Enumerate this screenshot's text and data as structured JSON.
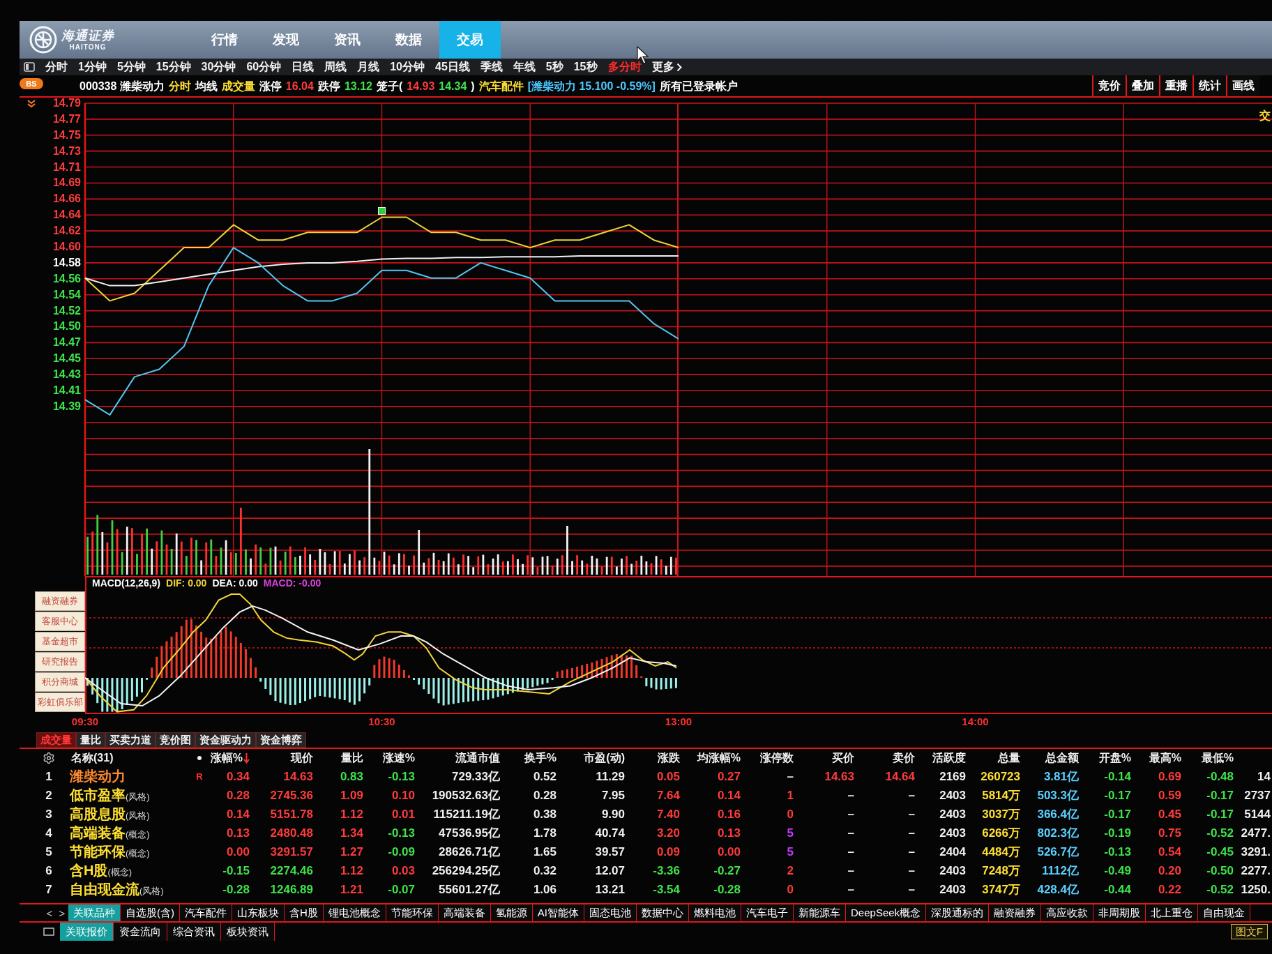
{
  "title_bar": {
    "logo_text": "海通证券",
    "logo_latin": "HAITONG",
    "menu": [
      {
        "label": "行情",
        "selected": false
      },
      {
        "label": "发现",
        "selected": false
      },
      {
        "label": "资讯",
        "selected": false
      },
      {
        "label": "数据",
        "selected": false
      },
      {
        "label": "交易",
        "selected": true
      }
    ]
  },
  "period_bar": {
    "items": [
      {
        "label": "分时",
        "selected": false
      },
      {
        "label": "1分钟",
        "selected": false
      },
      {
        "label": "5分钟",
        "selected": false
      },
      {
        "label": "15分钟",
        "selected": false
      },
      {
        "label": "30分钟",
        "selected": false
      },
      {
        "label": "60分钟",
        "selected": false
      },
      {
        "label": "日线",
        "selected": false
      },
      {
        "label": "周线",
        "selected": false
      },
      {
        "label": "月线",
        "selected": false
      },
      {
        "label": "10分钟",
        "selected": false
      },
      {
        "label": "45日线",
        "selected": false
      },
      {
        "label": "季线",
        "selected": false
      },
      {
        "label": "年线",
        "selected": false
      },
      {
        "label": "5秒",
        "selected": false
      },
      {
        "label": "15秒",
        "selected": false
      },
      {
        "label": "多分时",
        "selected": true
      }
    ],
    "more": "更多"
  },
  "info_bar": {
    "badge": "BS",
    "segments": [
      {
        "text": "000338 潍柴动力",
        "color": "#ffffff"
      },
      {
        "text": "分时",
        "color": "#ffe033"
      },
      {
        "text": "均线",
        "color": "#ffffff"
      },
      {
        "text": "成交量",
        "color": "#ffe033"
      },
      {
        "text": "涨停",
        "color": "#ffffff"
      },
      {
        "text": "16.04",
        "color": "#ff3b3b"
      },
      {
        "text": "跌停",
        "color": "#ffffff"
      },
      {
        "text": "13.12",
        "color": "#3ee34a"
      },
      {
        "text": "笼子(",
        "color": "#ffffff"
      },
      {
        "text": "14.93",
        "color": "#ff3b3b"
      },
      {
        "text": "14.34",
        "color": "#3ee34a"
      },
      {
        "text": ")",
        "color": "#ffffff"
      },
      {
        "text": "汽车配件",
        "color": "#ffe033"
      },
      {
        "text": "[潍柴动力 15.100 -0.59%]",
        "color": "#4cc9ff"
      },
      {
        "text": "所有已登录帐户",
        "color": "#ffffff"
      }
    ],
    "tools": [
      "竞价",
      "叠加",
      "重播",
      "统计",
      "画线"
    ]
  },
  "price_chart": {
    "edge_label": "交",
    "chart_data": [
      {
        "type": "line",
        "categories": [
          null,
          null,
          null,
          null,
          null,
          null,
          null,
          null,
          null,
          null,
          null,
          null,
          null,
          null,
          null,
          null,
          null,
          null,
          null,
          null,
          null,
          null,
          null,
          null,
          null
        ],
        "ylim": [
          14.168,
          14.79
        ],
        "yticks": [
          {
            "value": 14.79,
            "label": "14.79"
          },
          {
            "value": 14.769,
            "label": "14.77"
          },
          {
            "value": 14.748,
            "label": "14.75"
          },
          {
            "value": 14.727,
            "label": "14.73"
          },
          {
            "value": 14.706,
            "label": "14.71"
          },
          {
            "value": 14.685,
            "label": "14.69"
          },
          {
            "value": 14.664,
            "label": "14.66"
          },
          {
            "value": 14.643,
            "label": "14.64"
          },
          {
            "value": 14.622,
            "label": "14.62"
          },
          {
            "value": 14.601,
            "label": "14.60"
          },
          {
            "value": 14.58,
            "label": "14.58"
          },
          {
            "value": 14.559,
            "label": "14.56"
          },
          {
            "value": 14.538,
            "label": "14.54"
          },
          {
            "value": 14.517,
            "label": "14.52"
          },
          {
            "value": 14.496,
            "label": "14.50"
          },
          {
            "value": 14.475,
            "label": "14.47"
          },
          {
            "value": 14.454,
            "label": "14.45"
          },
          {
            "value": 14.433,
            "label": "14.43"
          },
          {
            "value": 14.412,
            "label": "14.41"
          },
          {
            "value": 14.391,
            "label": "14.39"
          }
        ],
        "tick_labels": "y",
        "grid": true,
        "series": [
          {
            "color": "#f2d43a",
            "values": [
              14.56,
              14.53,
              14.54,
              14.57,
              14.6,
              14.6,
              14.63,
              14.61,
              14.61,
              14.62,
              14.62,
              14.62,
              14.64,
              14.64,
              14.62,
              14.62,
              14.61,
              14.61,
              14.6,
              14.61,
              14.61,
              14.62,
              14.63,
              14.61,
              14.6
            ]
          },
          {
            "color": "#f0f0f0",
            "values": [
              14.56,
              14.55,
              14.55,
              14.555,
              14.56,
              14.565,
              14.57,
              14.575,
              14.578,
              14.58,
              14.58,
              14.582,
              14.585,
              14.586,
              14.586,
              14.587,
              14.587,
              14.588,
              14.588,
              14.588,
              14.589,
              14.589,
              14.589,
              14.589,
              14.589
            ]
          },
          {
            "color": "#52c6f2",
            "values": [
              14.4,
              14.38,
              14.43,
              14.44,
              14.47,
              14.55,
              14.6,
              14.58,
              14.55,
              14.53,
              14.53,
              14.54,
              14.57,
              14.57,
              14.56,
              14.56,
              14.58,
              14.57,
              14.56,
              14.53,
              14.53,
              14.53,
              14.53,
              14.5,
              14.48
            ]
          }
        ]
      }
    ]
  },
  "indicator": {
    "name": "MACD(12,26,9)",
    "values": [
      {
        "text": "DIF: 0.00",
        "color": "#f2d43a"
      },
      {
        "text": "DEA: 0.00",
        "color": "#ffffff"
      },
      {
        "text": "MACD: -0.00",
        "color": "#e040e0"
      }
    ],
    "time_axis": [
      "09:30",
      "10:30",
      "13:00",
      "14:00"
    ]
  },
  "side_menu": [
    "融资融券",
    "客服中心",
    "基金超市",
    "研究报告",
    "积分商城",
    "彩虹俱乐部"
  ],
  "chart_tabs": [
    {
      "label": "成交量",
      "selected": true
    },
    {
      "label": "量比",
      "selected": false
    },
    {
      "label": "买卖力道",
      "selected": false
    },
    {
      "label": "竞价图",
      "selected": false
    },
    {
      "label": "资金驱动力",
      "selected": false
    },
    {
      "label": "资金博弈",
      "selected": false
    }
  ],
  "table": {
    "name_header": "名称(31)",
    "columns": [
      {
        "label": "涨幅%",
        "sorted": true
      },
      {
        "label": "现价",
        "sorted": false
      },
      {
        "label": "量比",
        "sorted": false
      },
      {
        "label": "涨速%",
        "sorted": false
      },
      {
        "label": "流通市值",
        "sorted": false
      },
      {
        "label": "换手%",
        "sorted": false
      },
      {
        "label": "市盈(动)",
        "sorted": false
      },
      {
        "label": "涨跌",
        "sorted": false
      },
      {
        "label": "均涨幅%",
        "sorted": false
      },
      {
        "label": "涨停数",
        "sorted": false
      },
      {
        "label": "买价",
        "sorted": false
      },
      {
        "label": "卖价",
        "sorted": false
      },
      {
        "label": "活跃度",
        "sorted": false
      },
      {
        "label": "总量",
        "sorted": false
      },
      {
        "label": "总金额",
        "sorted": false
      },
      {
        "label": "开盘%",
        "sorted": false
      },
      {
        "label": "最高%",
        "sorted": false
      },
      {
        "label": "最低%",
        "sorted": false
      }
    ],
    "rows": [
      {
        "rank": "1",
        "name": {
          "text": "潍柴动力",
          "color": "#ff8a2e"
        },
        "flag": "R",
        "cells": [
          {
            "text": "0.34",
            "color": "#ff3b3b"
          },
          {
            "text": "14.63",
            "color": "#ff3b3b"
          },
          {
            "text": "0.83",
            "color": "#3ee34a"
          },
          {
            "text": "-0.13",
            "color": "#3ee34a"
          },
          {
            "text": "729.33亿",
            "color": "#f0f0f0"
          },
          {
            "text": "0.52",
            "color": "#f0f0f0"
          },
          {
            "text": "11.29",
            "color": "#f0f0f0"
          },
          {
            "text": "0.05",
            "color": "#ff3b3b"
          },
          {
            "text": "0.27",
            "color": "#ff3b3b"
          },
          {
            "text": "–",
            "color": "#f0f0f0"
          },
          {
            "text": "14.63",
            "color": "#ff3b3b"
          },
          {
            "text": "14.64",
            "color": "#ff3b3b"
          },
          {
            "text": "2169",
            "color": "#f0f0f0"
          },
          {
            "text": "260723",
            "color": "#ffe033"
          },
          {
            "text": "3.81亿",
            "color": "#5ad0ff"
          },
          {
            "text": "-0.14",
            "color": "#3ee34a"
          },
          {
            "text": "0.69",
            "color": "#ff3b3b"
          },
          {
            "text": "-0.48",
            "color": "#3ee34a"
          },
          {
            "text": "14",
            "color": "#f0f0f0"
          }
        ]
      },
      {
        "rank": "2",
        "name": {
          "text": "低市盈率",
          "color": "#ffe033"
        },
        "tag": "(风格)",
        "cells": [
          {
            "text": "0.28",
            "color": "#ff3b3b"
          },
          {
            "text": "2745.36",
            "color": "#ff3b3b"
          },
          {
            "text": "1.09",
            "color": "#ff3b3b"
          },
          {
            "text": "0.10",
            "color": "#ff3b3b"
          },
          {
            "text": "190532.63亿",
            "color": "#f0f0f0"
          },
          {
            "text": "0.28",
            "color": "#f0f0f0"
          },
          {
            "text": "7.95",
            "color": "#f0f0f0"
          },
          {
            "text": "7.64",
            "color": "#ff3b3b"
          },
          {
            "text": "0.14",
            "color": "#ff3b3b"
          },
          {
            "text": "1",
            "color": "#ff3b3b"
          },
          {
            "text": "–",
            "color": "#f0f0f0"
          },
          {
            "text": "–",
            "color": "#f0f0f0"
          },
          {
            "text": "2403",
            "color": "#f0f0f0"
          },
          {
            "text": "5814万",
            "color": "#ffe033"
          },
          {
            "text": "503.3亿",
            "color": "#5ad0ff"
          },
          {
            "text": "-0.17",
            "color": "#3ee34a"
          },
          {
            "text": "0.59",
            "color": "#ff3b3b"
          },
          {
            "text": "-0.17",
            "color": "#3ee34a"
          },
          {
            "text": "2737",
            "color": "#f0f0f0"
          }
        ]
      },
      {
        "rank": "3",
        "name": {
          "text": "高股息股",
          "color": "#ffe033"
        },
        "tag": "(风格)",
        "cells": [
          {
            "text": "0.14",
            "color": "#ff3b3b"
          },
          {
            "text": "5151.78",
            "color": "#ff3b3b"
          },
          {
            "text": "1.12",
            "color": "#ff3b3b"
          },
          {
            "text": "0.01",
            "color": "#ff3b3b"
          },
          {
            "text": "115211.19亿",
            "color": "#f0f0f0"
          },
          {
            "text": "0.38",
            "color": "#f0f0f0"
          },
          {
            "text": "9.90",
            "color": "#f0f0f0"
          },
          {
            "text": "7.40",
            "color": "#ff3b3b"
          },
          {
            "text": "0.16",
            "color": "#ff3b3b"
          },
          {
            "text": "0",
            "color": "#ff3b3b"
          },
          {
            "text": "–",
            "color": "#f0f0f0"
          },
          {
            "text": "–",
            "color": "#f0f0f0"
          },
          {
            "text": "2403",
            "color": "#f0f0f0"
          },
          {
            "text": "3037万",
            "color": "#ffe033"
          },
          {
            "text": "366.4亿",
            "color": "#5ad0ff"
          },
          {
            "text": "-0.17",
            "color": "#3ee34a"
          },
          {
            "text": "0.45",
            "color": "#ff3b3b"
          },
          {
            "text": "-0.17",
            "color": "#3ee34a"
          },
          {
            "text": "5144",
            "color": "#f0f0f0"
          }
        ]
      },
      {
        "rank": "4",
        "name": {
          "text": "高端装备",
          "color": "#ffe033"
        },
        "tag": "(概念)",
        "cells": [
          {
            "text": "0.13",
            "color": "#ff3b3b"
          },
          {
            "text": "2480.48",
            "color": "#ff3b3b"
          },
          {
            "text": "1.34",
            "color": "#ff3b3b"
          },
          {
            "text": "-0.13",
            "color": "#3ee34a"
          },
          {
            "text": "47536.95亿",
            "color": "#f0f0f0"
          },
          {
            "text": "1.78",
            "color": "#f0f0f0"
          },
          {
            "text": "40.74",
            "color": "#f0f0f0"
          },
          {
            "text": "3.20",
            "color": "#ff3b3b"
          },
          {
            "text": "0.13",
            "color": "#ff3b3b"
          },
          {
            "text": "5",
            "color": "#c43cff"
          },
          {
            "text": "–",
            "color": "#f0f0f0"
          },
          {
            "text": "–",
            "color": "#f0f0f0"
          },
          {
            "text": "2403",
            "color": "#f0f0f0"
          },
          {
            "text": "6266万",
            "color": "#ffe033"
          },
          {
            "text": "802.3亿",
            "color": "#5ad0ff"
          },
          {
            "text": "-0.19",
            "color": "#3ee34a"
          },
          {
            "text": "0.75",
            "color": "#ff3b3b"
          },
          {
            "text": "-0.52",
            "color": "#3ee34a"
          },
          {
            "text": "2477.",
            "color": "#f0f0f0"
          }
        ]
      },
      {
        "rank": "5",
        "name": {
          "text": "节能环保",
          "color": "#ffe033"
        },
        "tag": "(概念)",
        "cells": [
          {
            "text": "0.00",
            "color": "#ff3b3b"
          },
          {
            "text": "3291.57",
            "color": "#ff3b3b"
          },
          {
            "text": "1.27",
            "color": "#ff3b3b"
          },
          {
            "text": "-0.09",
            "color": "#3ee34a"
          },
          {
            "text": "28626.71亿",
            "color": "#f0f0f0"
          },
          {
            "text": "1.65",
            "color": "#f0f0f0"
          },
          {
            "text": "39.57",
            "color": "#f0f0f0"
          },
          {
            "text": "0.09",
            "color": "#ff3b3b"
          },
          {
            "text": "0.00",
            "color": "#ff3b3b"
          },
          {
            "text": "5",
            "color": "#c43cff"
          },
          {
            "text": "–",
            "color": "#f0f0f0"
          },
          {
            "text": "–",
            "color": "#f0f0f0"
          },
          {
            "text": "2404",
            "color": "#f0f0f0"
          },
          {
            "text": "4484万",
            "color": "#ffe033"
          },
          {
            "text": "526.7亿",
            "color": "#5ad0ff"
          },
          {
            "text": "-0.13",
            "color": "#3ee34a"
          },
          {
            "text": "0.54",
            "color": "#ff3b3b"
          },
          {
            "text": "-0.45",
            "color": "#3ee34a"
          },
          {
            "text": "3291.",
            "color": "#f0f0f0"
          }
        ]
      },
      {
        "rank": "6",
        "name": {
          "text": "含H股",
          "color": "#ffe033"
        },
        "tag": "(概念)",
        "cells": [
          {
            "text": "-0.15",
            "color": "#3ee34a"
          },
          {
            "text": "2274.46",
            "color": "#3ee34a"
          },
          {
            "text": "1.12",
            "color": "#ff3b3b"
          },
          {
            "text": "0.03",
            "color": "#ff3b3b"
          },
          {
            "text": "256294.25亿",
            "color": "#f0f0f0"
          },
          {
            "text": "0.32",
            "color": "#f0f0f0"
          },
          {
            "text": "12.07",
            "color": "#f0f0f0"
          },
          {
            "text": "-3.36",
            "color": "#3ee34a"
          },
          {
            "text": "-0.27",
            "color": "#3ee34a"
          },
          {
            "text": "2",
            "color": "#ff3b3b"
          },
          {
            "text": "–",
            "color": "#f0f0f0"
          },
          {
            "text": "–",
            "color": "#f0f0f0"
          },
          {
            "text": "2403",
            "color": "#f0f0f0"
          },
          {
            "text": "7248万",
            "color": "#ffe033"
          },
          {
            "text": "1112亿",
            "color": "#5ad0ff"
          },
          {
            "text": "-0.49",
            "color": "#3ee34a"
          },
          {
            "text": "0.20",
            "color": "#ff3b3b"
          },
          {
            "text": "-0.50",
            "color": "#3ee34a"
          },
          {
            "text": "2277.",
            "color": "#f0f0f0"
          }
        ]
      },
      {
        "rank": "7",
        "name": {
          "text": "自由现金流",
          "color": "#ffe033"
        },
        "tag": "(风格)",
        "cells": [
          {
            "text": "-0.28",
            "color": "#3ee34a"
          },
          {
            "text": "1246.89",
            "color": "#3ee34a"
          },
          {
            "text": "1.21",
            "color": "#ff3b3b"
          },
          {
            "text": "-0.07",
            "color": "#3ee34a"
          },
          {
            "text": "55601.27亿",
            "color": "#f0f0f0"
          },
          {
            "text": "1.06",
            "color": "#f0f0f0"
          },
          {
            "text": "13.21",
            "color": "#f0f0f0"
          },
          {
            "text": "-3.54",
            "color": "#3ee34a"
          },
          {
            "text": "-0.28",
            "color": "#3ee34a"
          },
          {
            "text": "0",
            "color": "#ff3b3b"
          },
          {
            "text": "–",
            "color": "#f0f0f0"
          },
          {
            "text": "–",
            "color": "#f0f0f0"
          },
          {
            "text": "2403",
            "color": "#f0f0f0"
          },
          {
            "text": "3747万",
            "color": "#ffe033"
          },
          {
            "text": "428.4亿",
            "color": "#5ad0ff"
          },
          {
            "text": "-0.44",
            "color": "#3ee34a"
          },
          {
            "text": "0.22",
            "color": "#ff3b3b"
          },
          {
            "text": "-0.52",
            "color": "#3ee34a"
          },
          {
            "text": "1250.",
            "color": "#f0f0f0"
          }
        ]
      }
    ]
  },
  "sector_tabs": {
    "nav": [
      "<",
      ">"
    ],
    "items": [
      {
        "label": "关联品种",
        "selected": true
      },
      {
        "label": "自选股(含)",
        "selected": false
      },
      {
        "label": "汽车配件",
        "selected": false
      },
      {
        "label": "山东板块",
        "selected": false
      },
      {
        "label": "含H股",
        "selected": false
      },
      {
        "label": "锂电池概念",
        "selected": false
      },
      {
        "label": "节能环保",
        "selected": false
      },
      {
        "label": "高端装备",
        "selected": false
      },
      {
        "label": "氢能源",
        "selected": false
      },
      {
        "label": "AI智能体",
        "selected": false
      },
      {
        "label": "固态电池",
        "selected": false
      },
      {
        "label": "数据中心",
        "selected": false
      },
      {
        "label": "燃料电池",
        "selected": false
      },
      {
        "label": "汽车电子",
        "selected": false
      },
      {
        "label": "新能源车",
        "selected": false
      },
      {
        "label": "DeepSeek概念",
        "selected": false
      },
      {
        "label": "深股通标的",
        "selected": false
      },
      {
        "label": "融资融券",
        "selected": false
      },
      {
        "label": "高应收款",
        "selected": false
      },
      {
        "label": "非周期股",
        "selected": false
      },
      {
        "label": "北上重仓",
        "selected": false
      },
      {
        "label": "自由现金",
        "selected": false
      }
    ]
  },
  "bottom_tabs": {
    "items": [
      {
        "label": "关联报价",
        "selected": true
      },
      {
        "label": "资金流向",
        "selected": false
      },
      {
        "label": "综合资讯",
        "selected": false
      },
      {
        "label": "板块资讯",
        "selected": false
      }
    ],
    "corner_button": "图文F"
  }
}
